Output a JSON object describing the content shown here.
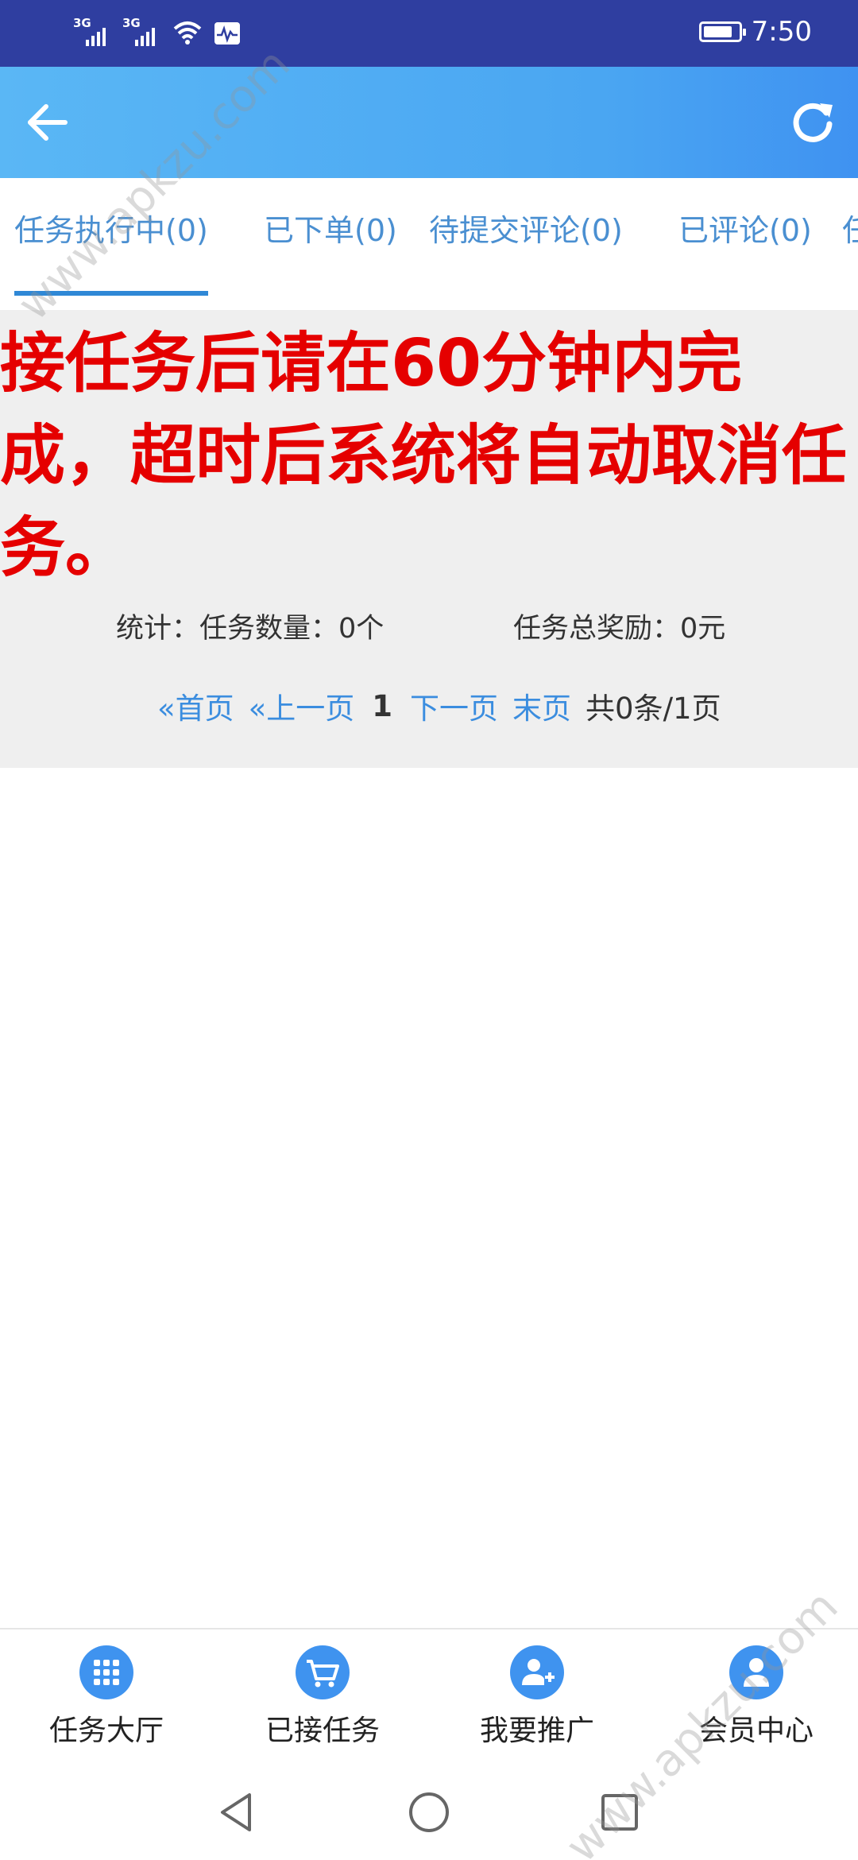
{
  "status_bar": {
    "signal1_tag": "3G",
    "signal2_tag": "3G",
    "time": "7:50",
    "battery_level": 0.85
  },
  "header": {
    "back_icon": "arrow-left-icon",
    "refresh_icon": "refresh-icon",
    "gradient_colors": [
      "#5ab7f5",
      "#3f92f1"
    ]
  },
  "tabs": [
    {
      "label": "任务执行中(0)",
      "active": true
    },
    {
      "label": "已下单(0)",
      "active": false
    },
    {
      "label": "待提交评论(0)",
      "active": false
    },
    {
      "label": "已评论(0)",
      "active": false
    },
    {
      "label": "任",
      "active": false
    }
  ],
  "notice": {
    "text": "接任务后请在60分钟内完成，超时后系统将自动取消任务。",
    "color": "#e50000"
  },
  "stats": {
    "task_count": "统计：任务数量：0个",
    "total_reward": "任务总奖励：0元"
  },
  "pager": {
    "first": "«首页",
    "prev": "«上一页",
    "current": "1",
    "next": "下一页",
    "last": "末页",
    "total": "共0条/1页"
  },
  "bottom_nav": [
    {
      "label": "任务大厅",
      "icon": "grid-icon"
    },
    {
      "label": "已接任务",
      "icon": "cart-icon"
    },
    {
      "label": "我要推广",
      "icon": "add-user-icon"
    },
    {
      "label": "会员中心",
      "icon": "user-icon"
    }
  ],
  "watermark": "www.apkzu.com",
  "colors": {
    "status_bar": "#2f3ea0",
    "accent": "#3f93ef",
    "tab_text": "#4a8fd1"
  }
}
